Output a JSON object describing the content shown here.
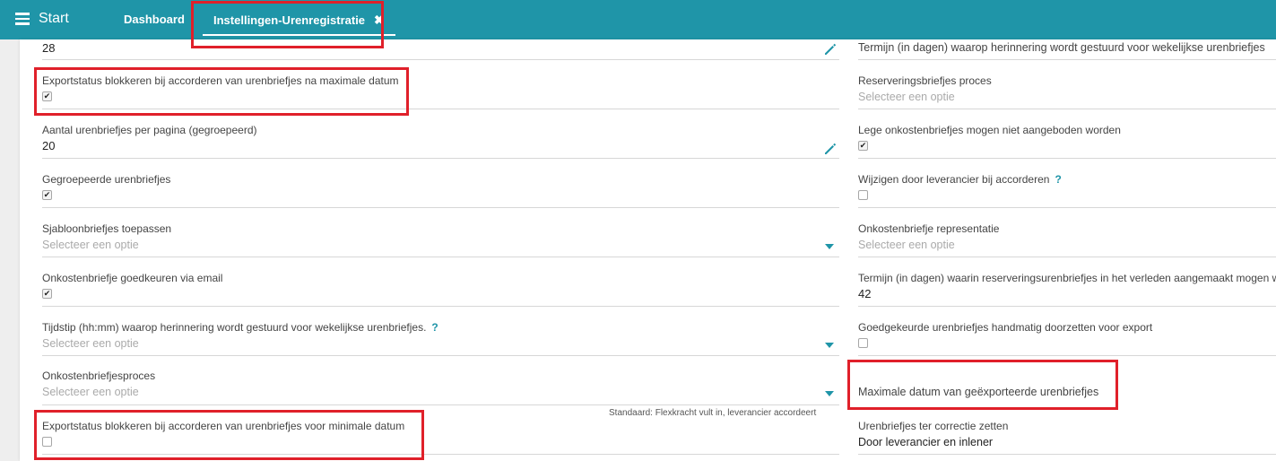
{
  "topbar": {
    "menu_label": "Start",
    "tabs": [
      {
        "label": "Dashboard"
      },
      {
        "label": "Instellingen-Urenregistratie",
        "close": "✖"
      }
    ]
  },
  "left_fields": [
    {
      "value": "28"
    },
    {
      "label": "Exportstatus blokkeren bij accorderen van urenbriefjes na maximale datum",
      "checkbox": "✔"
    },
    {
      "label": "Aantal urenbriefjes per pagina (gegroepeerd)",
      "value": "20"
    },
    {
      "label": "Gegroepeerde urenbriefjes",
      "checkbox": "✔"
    },
    {
      "label": "Sjabloonbriefjes toepassen",
      "placeholder": "Selecteer een optie"
    },
    {
      "label": "Onkostenbriefje goedkeuren via email",
      "checkbox": "✔"
    },
    {
      "label": "Tijdstip (hh:mm) waarop herinnering wordt gestuurd voor wekelijkse urenbriefjes.",
      "help": "?",
      "placeholder": "Selecteer een optie"
    },
    {
      "label": "Onkostenbriefjesproces",
      "placeholder": "Selecteer een optie",
      "hint": "Standaard: Flexkracht vult in, leverancier accordeert"
    },
    {
      "label": "Exportstatus blokkeren bij accorderen van urenbriefjes voor minimale datum",
      "checkbox": ""
    }
  ],
  "right_fields": [
    {
      "label": "Termijn (in dagen) waarop herinnering wordt gestuurd voor wekelijkse urenbriefjes"
    },
    {
      "label": "Reserveringsbriefjes proces",
      "placeholder": "Selecteer een optie"
    },
    {
      "label": "Lege onkostenbriefjes mogen niet aangeboden worden",
      "checkbox": "✔"
    },
    {
      "label": "Wijzigen door leverancier bij accorderen",
      "help": "?",
      "checkbox": ""
    },
    {
      "label": "Onkostenbriefje representatie",
      "placeholder": "Selecteer een optie"
    },
    {
      "label": "Termijn (in dagen) waarin reserveringsurenbriefjes in het verleden aangemaakt mogen worden",
      "value": "42"
    },
    {
      "label": "Goedgekeurde urenbriefjes handmatig doorzetten voor export",
      "checkbox": ""
    },
    {
      "label": "Maximale datum van geëxporteerde urenbriefjes"
    },
    {
      "label": "Urenbriefjes ter correctie zetten",
      "value": "Door leverancier en inlener"
    }
  ],
  "colors": {
    "header": "#1f95a8",
    "highlight": "#e0202a",
    "accent": "#1f95a8"
  },
  "icons": [
    "hamburger-icon",
    "close-icon",
    "pencil-icon",
    "chevron-down-icon",
    "help-icon"
  ]
}
